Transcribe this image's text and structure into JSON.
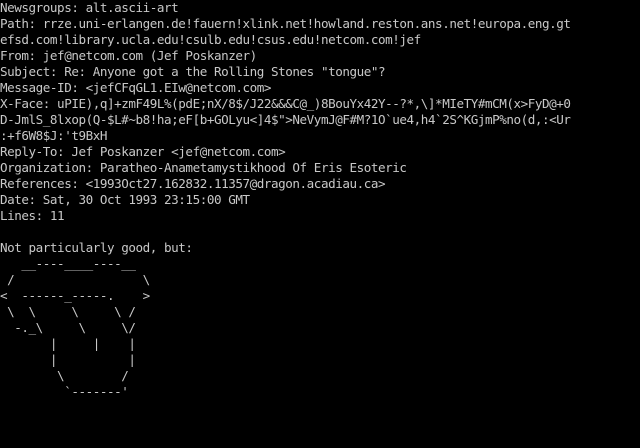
{
  "colors": {
    "background": "#000000",
    "text": "#c8c8c8"
  },
  "header_lines": [
    "Newsgroups: alt.ascii-art",
    "Path: rrze.uni-erlangen.de!fauern!xlink.net!howland.reston.ans.net!europa.eng.gt",
    "efsd.com!library.ucla.edu!csulb.edu!csus.edu!netcom.com!jef",
    "From: jef@netcom.com (Jef Poskanzer)",
    "Subject: Re: Anyone got a the Rolling Stones \"tongue\"?",
    "Message-ID: <jefCFqGL1.EIw@netcom.com>",
    "X-Face: uPIE),q]+zmF49L%(pdE;nX/8$/J22&&&C@_)8BouYx42Y--?*,\\]*MIeTY#mCM(x>FyD@+0",
    "D-JmlS_8lxop(Q-$L#~b8!ha;eF[b+GOLyu<]4$\">NeVymJ@F#M?1O`ue4,h4`2S^KGjmP%no(d,:<Ur",
    ":+f6W8$J:'t9BxH",
    "Reply-To: Jef Poskanzer <jef@netcom.com>",
    "Organization: Paratheo-Anametamystikhood Of Eris Esoteric",
    "References: <1993Oct27.162832.11357@dragon.acadiau.ca>",
    "Date: Sat, 30 Oct 1993 23:15:00 GMT",
    "Lines: 11"
  ],
  "body_text": "Not particularly good, but:",
  "ascii_art_lines": [
    "   __----____----__",
    " /                  \\",
    "<  ------_-----.    >",
    " \\  \\     \\     \\ /",
    "  -._\\     \\     \\/",
    "       |     |    |",
    "       |          |",
    "        \\        /",
    "         `-------'"
  ]
}
